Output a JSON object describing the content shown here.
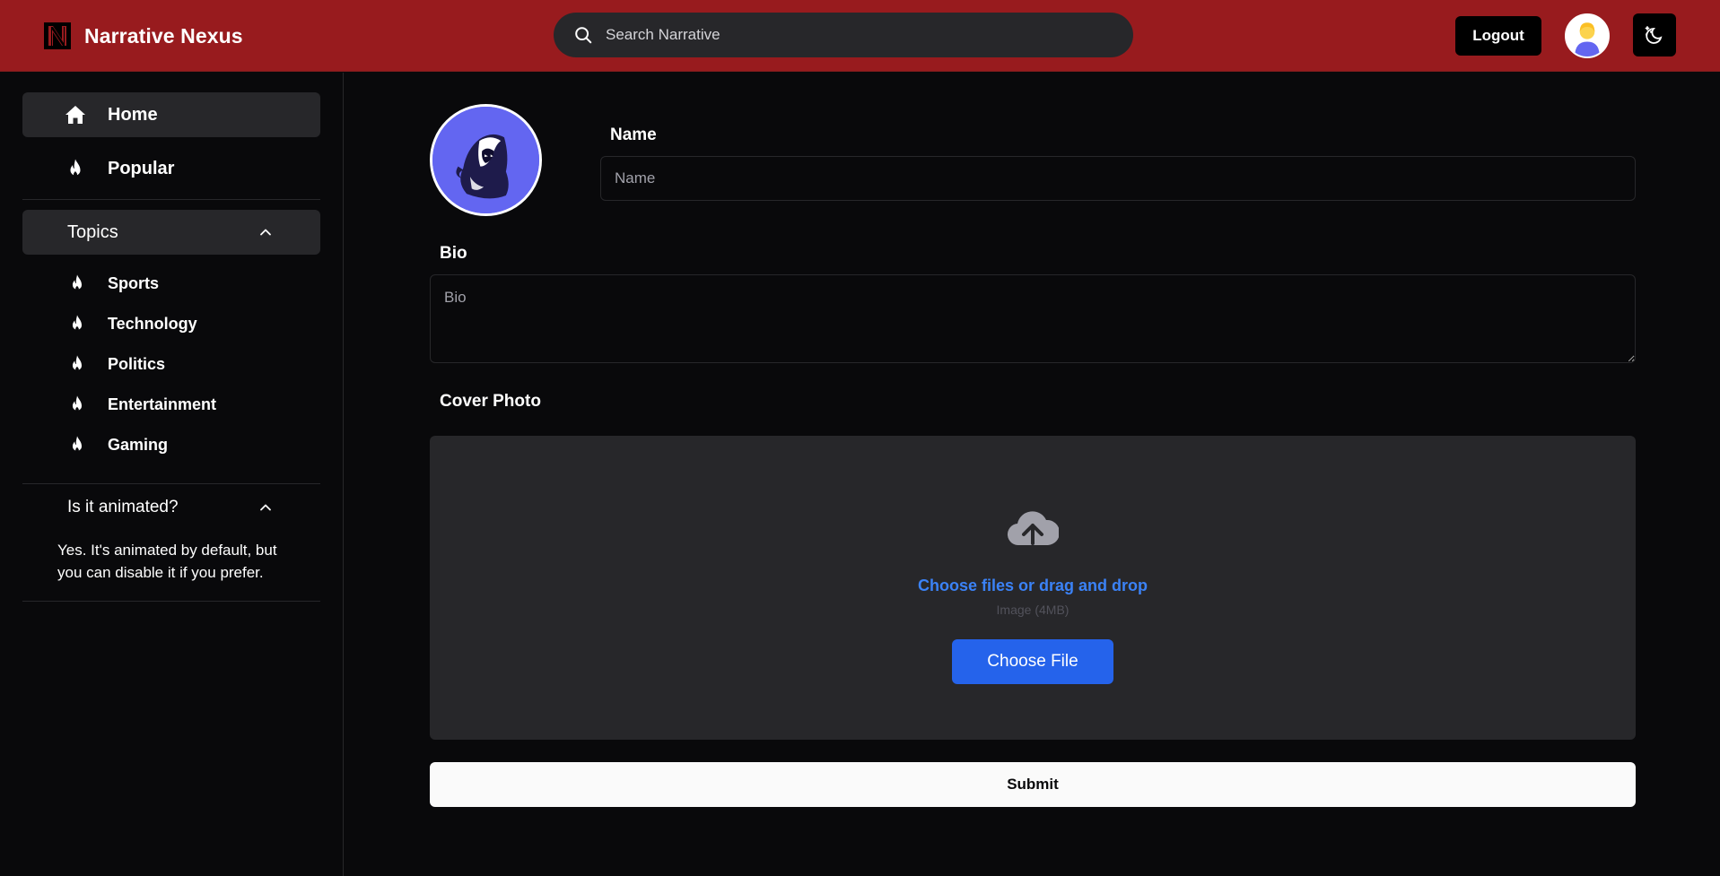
{
  "header": {
    "brand_name": "Narrative Nexus",
    "brand_logo_icon": "n-logo-icon",
    "search_placeholder": "Search Narrative",
    "search_icon": "search-icon",
    "logout_label": "Logout",
    "avatar_icon": "user-avatar-icon",
    "theme_toggle_icon": "moon-stars-icon"
  },
  "sidebar": {
    "nav": [
      {
        "label": "Home",
        "icon": "home-icon"
      },
      {
        "label": "Popular",
        "icon": "flame-icon"
      }
    ],
    "topics": {
      "label": "Topics",
      "items": [
        {
          "label": "Sports",
          "icon": "flame-icon"
        },
        {
          "label": "Technology",
          "icon": "flame-icon"
        },
        {
          "label": "Politics",
          "icon": "flame-icon"
        },
        {
          "label": "Entertainment",
          "icon": "flame-icon"
        },
        {
          "label": "Gaming",
          "icon": "flame-icon"
        }
      ]
    },
    "faq": {
      "question": "Is it animated?",
      "answer": "Yes. It's animated by default, but you can disable it if you prefer."
    }
  },
  "form": {
    "profile_image_icon": "hooded-figure-avatar",
    "name_label": "Name",
    "name_placeholder": "Name",
    "name_value": "",
    "bio_label": "Bio",
    "bio_placeholder": "Bio",
    "bio_value": "",
    "cover_label": "Cover Photo",
    "dropzone": {
      "icon": "cloud-upload-icon",
      "text": "Choose files or drag and drop",
      "subtext": "Image (4MB)",
      "button_label": "Choose File"
    },
    "submit_label": "Submit"
  },
  "colors": {
    "header_bg": "#981b1e",
    "page_bg": "#09090b",
    "panel_bg": "#27272a",
    "link_blue": "#3b82f6",
    "button_blue": "#2563eb",
    "profile_bg": "#6366f1"
  }
}
